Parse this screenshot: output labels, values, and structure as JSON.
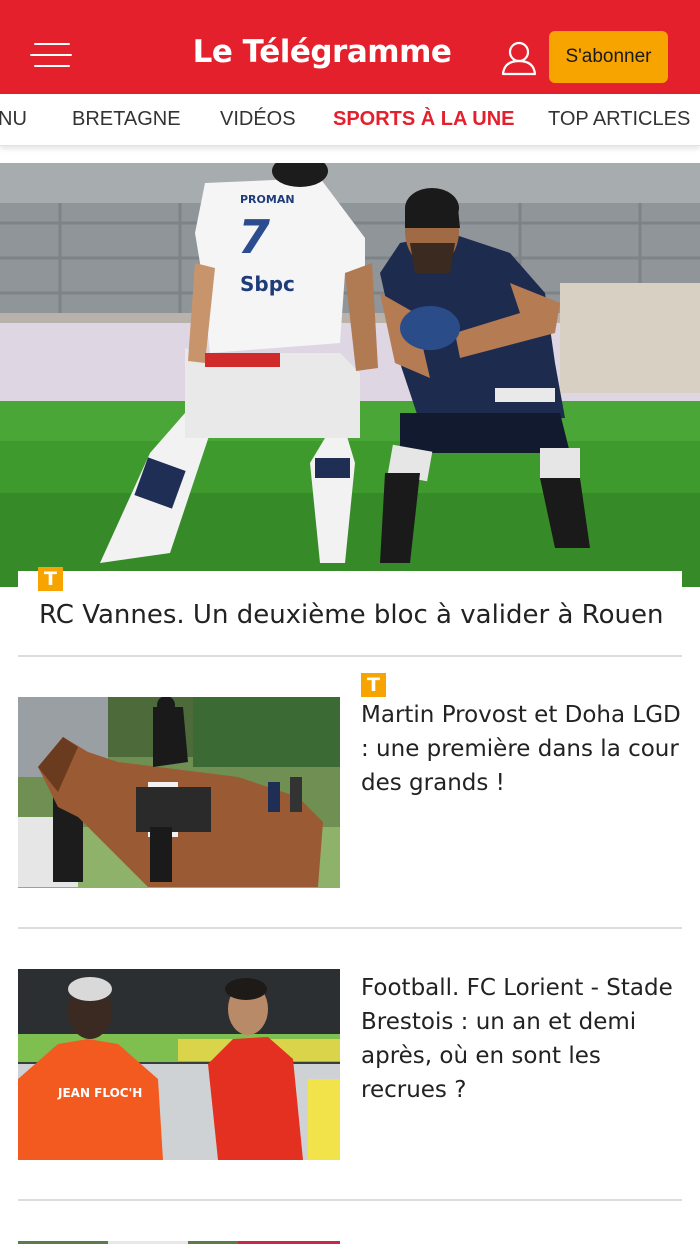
{
  "header": {
    "logo": "Le Télégramme",
    "subscribe_label": "S'abonner",
    "brand_color": "#e3202b",
    "accent_color": "#f7a300"
  },
  "nav": {
    "items": [
      {
        "label": "NU",
        "active": false
      },
      {
        "label": "BRETAGNE",
        "active": false
      },
      {
        "label": "VIDÉOS",
        "active": false
      },
      {
        "label": "SPORTS À LA UNE",
        "active": true
      },
      {
        "label": "TOP ARTICLES",
        "active": false
      }
    ]
  },
  "hero": {
    "badge": "T",
    "title": "RC Vannes. Un deuxième bloc à valider à Rouen",
    "photo": {
      "jersey_number": "7",
      "sponsor": "Sbpc",
      "brand": "PROMAN"
    }
  },
  "articles": [
    {
      "badge": "T",
      "title": "Martin Provost et Doha LGD : une première dans la cour des grands !"
    },
    {
      "badge": "",
      "title": "Football. FC Lorient - Stade Brestois : un an et demi après, où en sont les recrues ?",
      "photo": {
        "jersey_text": "JEAN FLOC'H"
      }
    }
  ]
}
